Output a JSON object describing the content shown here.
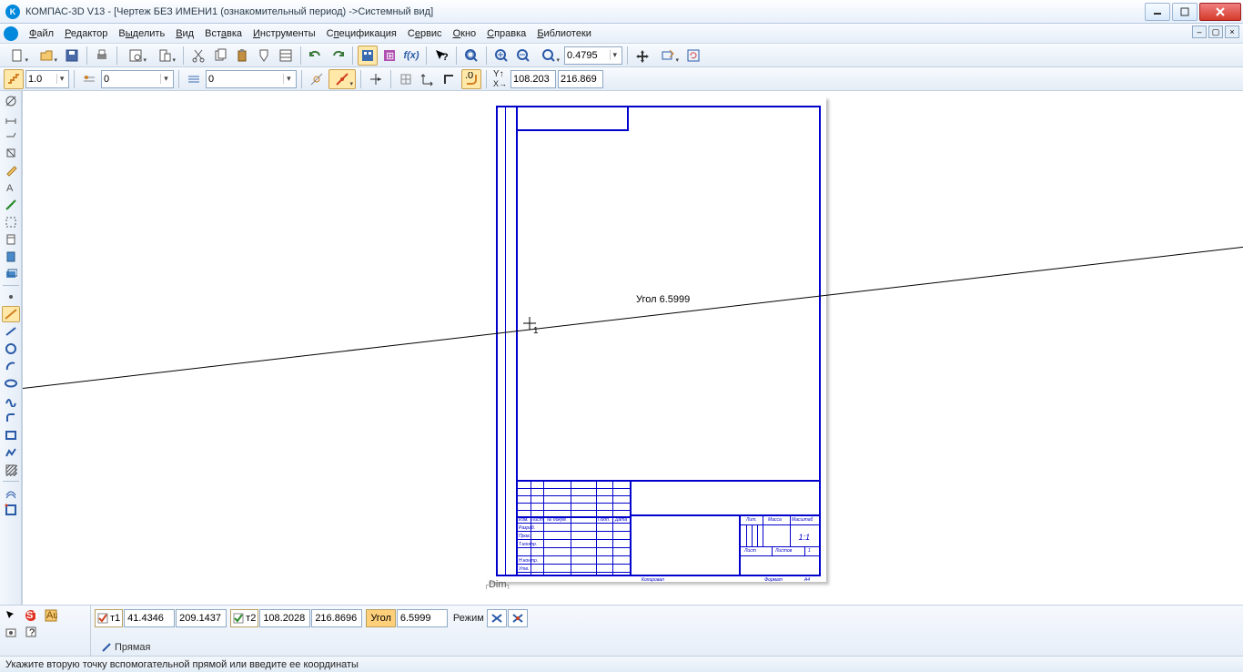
{
  "title": "КОМПАС-3D V13 - [Чертеж БЕЗ ИМЕНИ1 (ознакомительный период) ->Системный вид]",
  "menu": {
    "file": "Файл",
    "edit": "Редактор",
    "select": "Выделить",
    "view": "Вид",
    "insert": "Вставка",
    "tools": "Инструменты",
    "spec": "Спецификация",
    "service": "Сервис",
    "window": "Окно",
    "help": "Справка",
    "libs": "Библиотеки"
  },
  "tb1": {
    "zoom_value": "0.4795"
  },
  "tb2": {
    "step": "1.0",
    "style1": "0",
    "style2": "0",
    "x_label": "X↓",
    "y_label": "Y↑",
    "x_val": "108.203",
    "y_val": "216.869"
  },
  "canvas": {
    "angle_label": "Угол 6.5999",
    "cursor_label": "1",
    "dim_label": "Dim"
  },
  "titleblock": {
    "izm": "Изм.",
    "list": "Лист",
    "ndokum": "№ докум.",
    "podp": "Подп.",
    "data": "Дата",
    "razrab": "Разраб.",
    "prov": "Пров.",
    "tkontr": "Т.контр.",
    "nkontr": "Н.контр.",
    "utv": "Утв.",
    "lit": "Лит.",
    "massa": "Масса",
    "masstab": "Масштаб",
    "scale": "1:1",
    "list2": "Лист",
    "listov": "Листов",
    "one": "1",
    "kopiroval": "Копировал",
    "format": "Формат",
    "a4": "A4"
  },
  "prop": {
    "t1_label": "т1",
    "t1_x": "41.4346",
    "t1_y": "209.1437",
    "t2_label": "т2",
    "t2_x": "108.2028",
    "t2_y": "216.8696",
    "angle_label": "Угол",
    "angle_val": "6.5999",
    "mode_label": "Режим",
    "tab": "Прямая"
  },
  "status": "Укажите вторую точку вспомогательной прямой или введите ее координаты"
}
